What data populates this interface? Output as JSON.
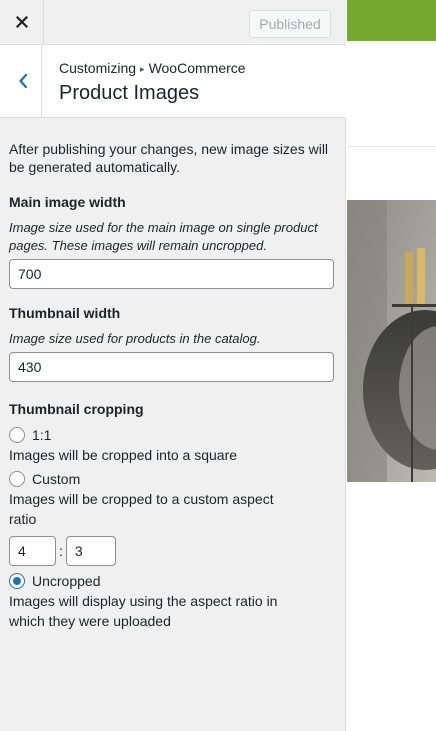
{
  "topbar": {
    "close_icon": "close-icon",
    "publish_label": "Published"
  },
  "section": {
    "back_icon": "chevron-left-icon",
    "breadcrumb_parent": "Customizing",
    "breadcrumb_separator": "▸",
    "breadcrumb_current": "WooCommerce",
    "title": "Product Images"
  },
  "notice": "After publishing your changes, new image sizes will be generated automatically.",
  "main_image": {
    "title": "Main image width",
    "description": "Image size used for the main image on single product pages. These images will remain uncropped.",
    "value": "700"
  },
  "thumbnail": {
    "title": "Thumbnail width",
    "description": "Image size used for products in the catalog.",
    "value": "430"
  },
  "cropping": {
    "title": "Thumbnail cropping",
    "options": [
      {
        "label": "1:1",
        "description": "Images will be cropped into a square",
        "checked": false
      },
      {
        "label": "Custom",
        "description": "Images will be cropped to a custom aspect ratio",
        "checked": false
      },
      {
        "label": "Uncropped",
        "description": "Images will display using the aspect ratio in which they were uploaded",
        "checked": true
      }
    ],
    "ratio_width": "4",
    "ratio_separator": ":",
    "ratio_height": "3"
  },
  "colors": {
    "accent": "#2271b1",
    "preview_header": "#76aa2f",
    "sidebar_bg": "#f0f0f1"
  }
}
